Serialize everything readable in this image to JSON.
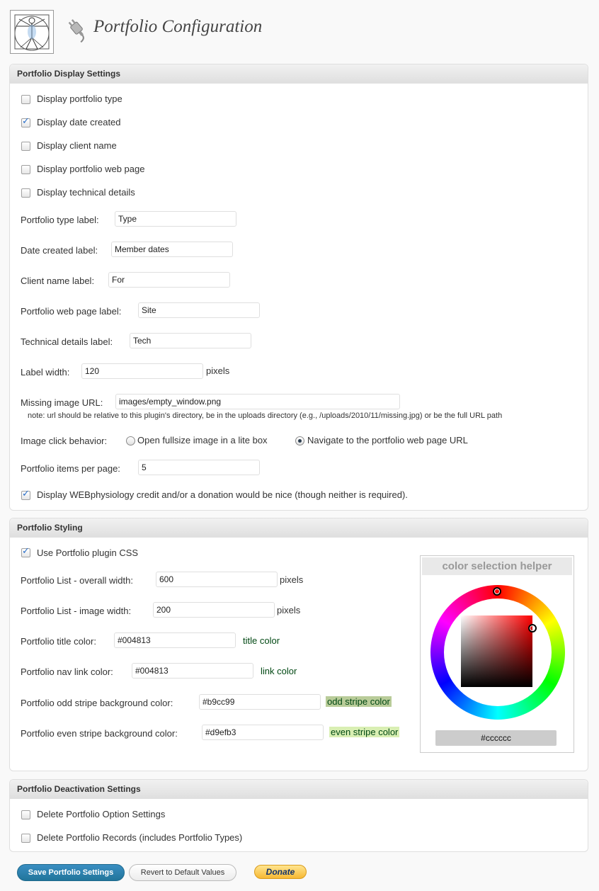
{
  "header": {
    "title": "Portfolio Configuration"
  },
  "display": {
    "heading": "Portfolio Display Settings",
    "checkboxes": [
      {
        "label": "Display portfolio type",
        "checked": false
      },
      {
        "label": "Display date created",
        "checked": true
      },
      {
        "label": "Display client name",
        "checked": false
      },
      {
        "label": "Display portfolio web page",
        "checked": false
      },
      {
        "label": "Display technical details",
        "checked": false
      }
    ],
    "fields": [
      {
        "label": "Portfolio type label:",
        "value": "Type"
      },
      {
        "label": "Date created label:",
        "value": "Member dates"
      },
      {
        "label": "Client name label:",
        "value": "For"
      },
      {
        "label": "Portfolio web page label:",
        "value": "Site"
      },
      {
        "label": "Technical details label:",
        "value": "Tech"
      }
    ],
    "label_width": {
      "label": "Label width:",
      "value": "120",
      "unit": "pixels"
    },
    "missing_image": {
      "label": "Missing image URL:",
      "value": "images/empty_window.png",
      "note": "note: url should be relative to this plugin's directory, be in the uploads directory (e.g., /uploads/2010/11/missing.jpg) or be the full URL path"
    },
    "click_behavior": {
      "label": "Image click behavior:",
      "option_lightbox": "Open fullsize image in a lite box",
      "option_navigate": "Navigate to the portfolio web page URL",
      "selected": "navigate"
    },
    "items_per_page": {
      "label": "Portfolio items per page:",
      "value": "5"
    },
    "credit": {
      "label": "Display WEBphysiology credit and/or a donation would be nice (though neither is required).",
      "checked": true
    }
  },
  "styling": {
    "heading": "Portfolio Styling",
    "use_css": {
      "label": "Use Portfolio plugin CSS",
      "checked": true
    },
    "overall_width": {
      "label": "Portfolio List - overall width:",
      "value": "600",
      "unit": "pixels"
    },
    "image_width": {
      "label": "Portfolio List - image width:",
      "value": "200",
      "unit": "pixels"
    },
    "title_color": {
      "label": "Portfolio title color:",
      "value": "#004813",
      "sample": "title color",
      "color": "#004813"
    },
    "nav_color": {
      "label": "Portfolio nav link color:",
      "value": "#004813",
      "sample": "link color",
      "color": "#004813"
    },
    "odd_stripe": {
      "label": "Portfolio odd stripe background color:",
      "value": "#b9cc99",
      "sample": "odd stripe color",
      "color": "#b9cc99"
    },
    "even_stripe": {
      "label": "Portfolio even stripe background color:",
      "value": "#d9efb3",
      "sample": "even stripe color",
      "color": "#d9efb3"
    },
    "helper": {
      "title": "color selection helper",
      "value": "#cccccc"
    }
  },
  "deactivation": {
    "heading": "Portfolio Deactivation Settings",
    "delete_options": {
      "label": "Delete Portfolio Option Settings",
      "checked": false
    },
    "delete_records": {
      "label": "Delete Portfolio Records (includes Portfolio Types)",
      "checked": false
    }
  },
  "actions": {
    "save": "Save Portfolio Settings",
    "revert": "Revert to Default Values",
    "donate": "Donate"
  }
}
